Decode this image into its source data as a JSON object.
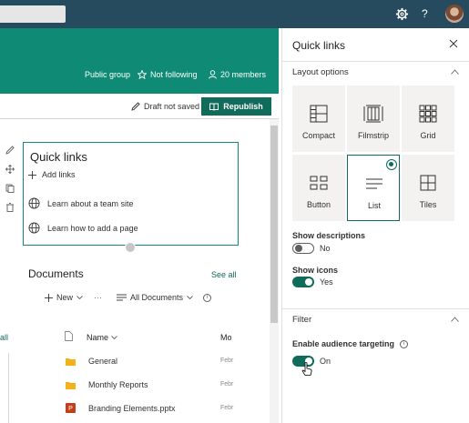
{
  "suite": {
    "help_glyph": "?"
  },
  "site_header": {
    "group_type": "Public group",
    "follow_label": "Not following",
    "members_label": "20 members"
  },
  "command_bar": {
    "draft_label": "Draft not saved",
    "republish_label": "Republish"
  },
  "quicklinks_webpart": {
    "title": "Quick links",
    "add_label": "Add links",
    "links": [
      {
        "label": "Learn about a team site"
      },
      {
        "label": "Learn how to add a page"
      }
    ]
  },
  "documents": {
    "title": "Documents",
    "see_all": "See all",
    "new_label": "New",
    "more_label": "···",
    "view_label": "All Documents",
    "columns": {
      "name": "Name",
      "modified": "Mo"
    },
    "rows": [
      {
        "name": "General",
        "type": "folder",
        "modified": "Febr"
      },
      {
        "name": "Monthly Reports",
        "type": "folder",
        "modified": "Febr"
      },
      {
        "name": "Branding Elements.pptx",
        "type": "pptx",
        "modified": "Febr"
      }
    ],
    "left_all": "all"
  },
  "panel": {
    "title": "Quick links",
    "layout_section": "Layout options",
    "layouts": [
      {
        "label": "Compact",
        "icon": "compact-icon",
        "selected": false
      },
      {
        "label": "Filmstrip",
        "icon": "filmstrip-icon",
        "selected": false
      },
      {
        "label": "Grid",
        "icon": "grid-icon",
        "selected": false
      },
      {
        "label": "Button",
        "icon": "button-icon",
        "selected": false
      },
      {
        "label": "List",
        "icon": "list-icon",
        "selected": true
      },
      {
        "label": "Tiles",
        "icon": "tiles-icon",
        "selected": false
      }
    ],
    "show_descriptions": {
      "label": "Show descriptions",
      "state": "No",
      "on": false
    },
    "show_icons": {
      "label": "Show icons",
      "state": "Yes",
      "on": true
    },
    "filter_section": "Filter",
    "audience": {
      "label": "Enable audience targeting",
      "state": "On",
      "on": true
    }
  },
  "colors": {
    "suite_bar": "#264a5e",
    "header_teal": "#0f8a74",
    "accent": "#0f6b5a"
  }
}
